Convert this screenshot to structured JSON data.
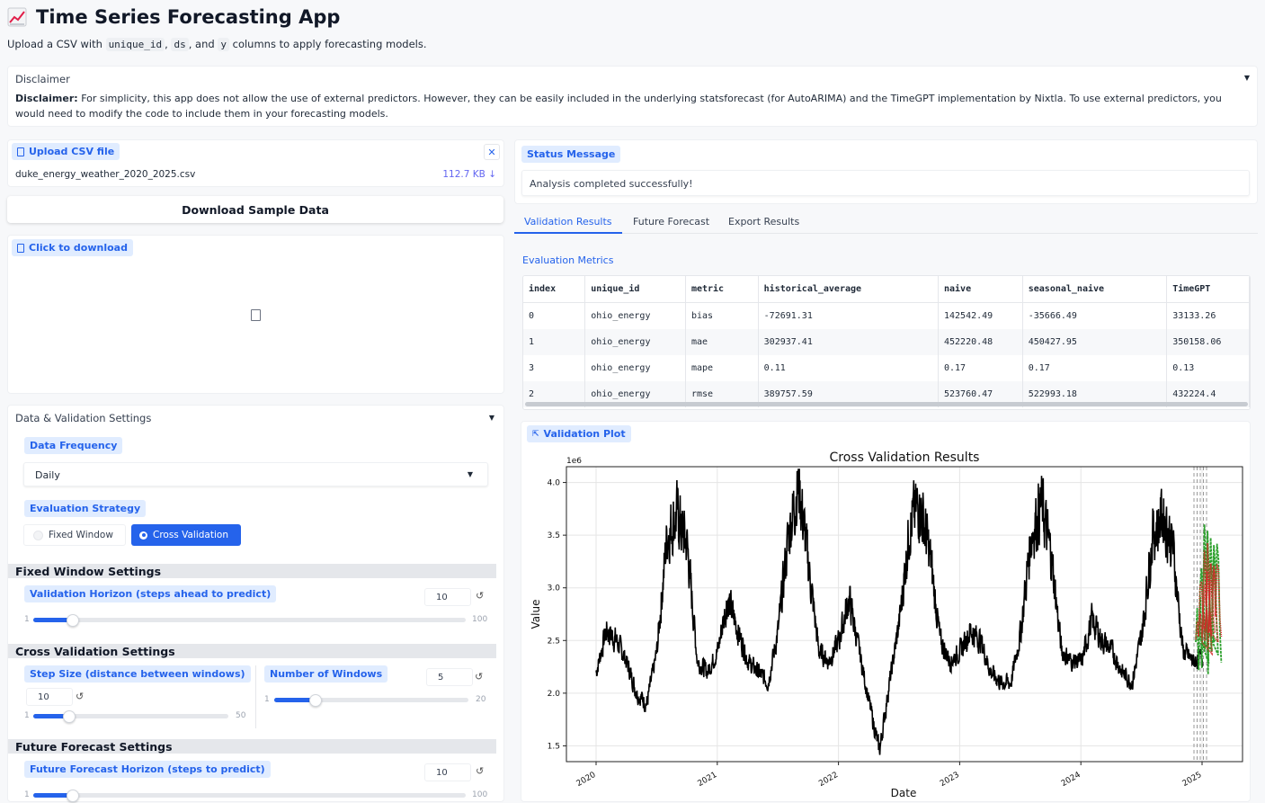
{
  "app": {
    "title": "Time Series Forecasting App",
    "subtitle_pre": "Upload a CSV with",
    "subtitle_code1": "unique_id",
    "subtitle_code2": "ds",
    "subtitle_and": ", and",
    "subtitle_code3": "y",
    "subtitle_post": "columns to apply forecasting models."
  },
  "disclaimer": {
    "header": "Disclaimer",
    "bold": "Disclaimer:",
    "text": "For simplicity, this app does not allow the use of external predictors. However, they can be easily included in the underlying statsforecast (for AutoARIMA) and the TimeGPT implementation by Nixtla. To use external predictors, you would need to modify the code to include them in your forecasting models."
  },
  "upload": {
    "label": "Upload CSV file",
    "filename": "duke_energy_weather_2020_2025.csv",
    "size": "112.7 KB ↓"
  },
  "download_button": "Download Sample Data",
  "click_download_label": "Click to download",
  "settings": {
    "header": "Data & Validation Settings",
    "frequency_label": "Data Frequency",
    "frequency_value": "Daily",
    "strategy_label": "Evaluation Strategy",
    "strategy_options": [
      "Fixed Window",
      "Cross Validation"
    ],
    "fixed_header": "Fixed Window Settings",
    "horizon_label": "Validation Horizon (steps ahead to predict)",
    "horizon_value": "10",
    "horizon_min": "1",
    "horizon_max": "100",
    "horizon_level": 0.09,
    "cv_header": "Cross Validation Settings",
    "step_label": "Step Size (distance between windows)",
    "step_value": "10",
    "step_min": "1",
    "step_max": "50",
    "step_level": 0.18,
    "windows_label": "Number of Windows",
    "windows_value": "5",
    "windows_min": "1",
    "windows_max": "20",
    "windows_level": 0.21,
    "future_header": "Future Forecast Settings",
    "future_label": "Future Forecast Horizon (steps to predict)",
    "future_value": "10",
    "future_min": "1",
    "future_max": "100",
    "future_level": 0.09
  },
  "status": {
    "label": "Status Message",
    "text": "Analysis completed successfully!"
  },
  "tabs": [
    "Validation Results",
    "Future Forecast",
    "Export Results"
  ],
  "metrics": {
    "title": "Evaluation Metrics",
    "columns": [
      "index",
      "unique_id",
      "metric",
      "historical_average",
      "naive",
      "seasonal_naive",
      "TimeGPT"
    ],
    "rows": [
      [
        "0",
        "ohio_energy",
        "bias",
        "-72691.31",
        "142542.49",
        "-35666.49",
        "33133.26"
      ],
      [
        "1",
        "ohio_energy",
        "mae",
        "302937.41",
        "452220.48",
        "450427.95",
        "350158.06"
      ],
      [
        "3",
        "ohio_energy",
        "mape",
        "0.11",
        "0.17",
        "0.17",
        "0.13"
      ],
      [
        "2",
        "ohio_energy",
        "rmse",
        "389757.59",
        "523760.47",
        "522993.18",
        "432224.4"
      ]
    ]
  },
  "plot_label": "Validation Plot",
  "chart_data": {
    "type": "line",
    "title": "Cross Validation Results",
    "xlabel": "Date",
    "ylabel": "Value",
    "y_multiplier": "1e6",
    "x_ticks": [
      "2020",
      "2021",
      "2022",
      "2023",
      "2024",
      "2025"
    ],
    "y_ticks": [
      "1.5",
      "2.0",
      "2.5",
      "3.0",
      "3.5",
      "4.0"
    ],
    "ylim": [
      1.35,
      4.15
    ],
    "grid": true,
    "series": [
      {
        "color": "#000000",
        "values_monthly": [
          2.2,
          2.6,
          2.5,
          2.3,
          2.0,
          1.9,
          2.4,
          3.5,
          3.7,
          3.4,
          2.3,
          2.2,
          2.4,
          2.9,
          2.6,
          2.3,
          2.2,
          2.1,
          2.6,
          3.5,
          4.0,
          3.2,
          2.4,
          2.3,
          2.5,
          2.9,
          2.4,
          1.9,
          1.45,
          2.1,
          2.7,
          3.6,
          3.8,
          3.3,
          2.5,
          2.3,
          2.4,
          2.6,
          2.5,
          2.2,
          2.1,
          2.1,
          2.6,
          3.5,
          3.8,
          3.3,
          2.4,
          2.3,
          2.3,
          2.7,
          2.5,
          2.4,
          2.2,
          2.1,
          2.6,
          3.5,
          3.7,
          3.4,
          2.4,
          2.3,
          2.35
        ]
      },
      {
        "color": "#2ca02c",
        "values": [
          2.5,
          2.8,
          2.3,
          3.0,
          3.3,
          2.9,
          3.5,
          3.2,
          2.6,
          2.4
        ]
      },
      {
        "color": "#d62728",
        "values": [
          2.6,
          2.7,
          2.5,
          2.9,
          3.1,
          2.8,
          3.3,
          3.1,
          2.7,
          2.5
        ]
      }
    ]
  }
}
